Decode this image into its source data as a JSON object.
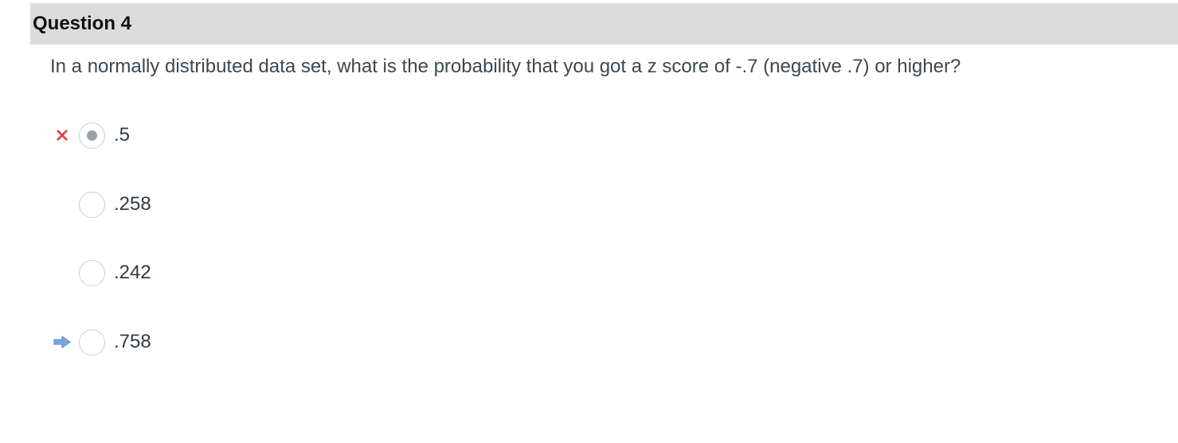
{
  "question": {
    "title": "Question 4",
    "text": "In a normally distributed data set, what is the probability that you got a z score of -.7 (negative .7) or higher?"
  },
  "answers": [
    {
      "label": ".5",
      "selected": true,
      "marker": "incorrect-x-icon"
    },
    {
      "label": ".258",
      "selected": false,
      "marker": ""
    },
    {
      "label": ".242",
      "selected": false,
      "marker": ""
    },
    {
      "label": ".758",
      "selected": false,
      "marker": "correct-answer-arrow-icon"
    }
  ],
  "colors": {
    "header_bg": "#dcdcdc",
    "incorrect": "#e0474c",
    "correct_arrow": "#7fa6d9"
  }
}
